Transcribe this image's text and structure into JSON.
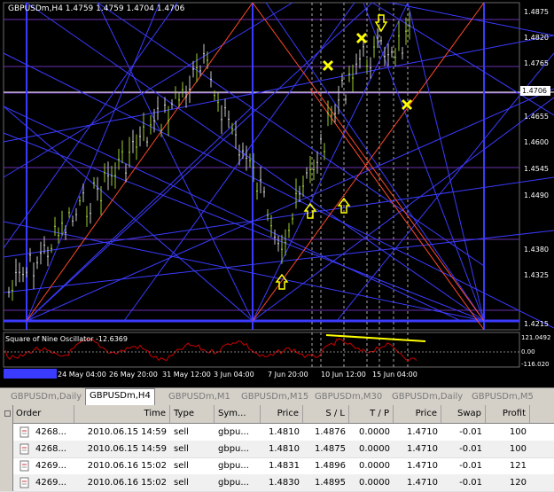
{
  "chart": {
    "symbol_label": "GBPUSDm,H4  1.4759 1.4759 1.4704 1.4706",
    "current_price": "1.4706",
    "price_axis": [
      "1.4875",
      "1.4820",
      "1.4765",
      "1.4655",
      "1.4600",
      "1.4545",
      "1.4490",
      "1.4380",
      "1.4325",
      "1.4215"
    ],
    "oscillator_label": "Square of Nine Oscillator -12.6369",
    "osc_axis": [
      "121.0492",
      "0.00",
      "-116.020"
    ],
    "time_axis": [
      "24 May 04:00",
      "26 May 20:00",
      "31 May 12:00",
      "3 Jun 04:00",
      "7 Jun 20:00",
      "10 Jun 12:00",
      "15 Jun 04:00"
    ],
    "colors": {
      "background": "#000000",
      "blue_lines": "#3b3bff",
      "red_lines": "#ff4a2a",
      "purple_lines": "#8a2be2",
      "marker": "#ffff00",
      "oscillator": "#cc0000"
    }
  },
  "tabs": [
    "GBPUSDm,Daily",
    "GBPUSDm,H4",
    "GBPUSDm,M1",
    "GBPUSDm,M15",
    "GBPUSDm,M30",
    "GBPUSDm,Daily",
    "GBPUSDm,M5"
  ],
  "active_tab": 1,
  "table": {
    "headers": [
      "Order",
      "Time",
      "Type",
      "Sym...",
      "Price",
      "S / L",
      "T / P",
      "Price",
      "Swap",
      "Profit"
    ],
    "rows": [
      {
        "order": "4268...",
        "time": "2010.06.15 14:59",
        "type": "sell",
        "symbol": "gbpu...",
        "price": "1.4810",
        "sl": "1.4876",
        "tp": "0.0000",
        "cur": "1.4710",
        "swap": "-0.01",
        "profit": "100"
      },
      {
        "order": "4268...",
        "time": "2010.06.15 14:59",
        "type": "sell",
        "symbol": "gbpu...",
        "price": "1.4810",
        "sl": "1.4875",
        "tp": "0.0000",
        "cur": "1.4710",
        "swap": "-0.01",
        "profit": "100"
      },
      {
        "order": "4269...",
        "time": "2010.06.16 15:02",
        "type": "sell",
        "symbol": "gbpu...",
        "price": "1.4831",
        "sl": "1.4896",
        "tp": "0.0000",
        "cur": "1.4710",
        "swap": "-0.01",
        "profit": "121"
      },
      {
        "order": "4269...",
        "time": "2010.06.16 15:02",
        "type": "sell",
        "symbol": "gbpu...",
        "price": "1.4830",
        "sl": "1.4895",
        "tp": "0.0000",
        "cur": "1.4710",
        "swap": "-0.01",
        "profit": "120"
      }
    ]
  }
}
